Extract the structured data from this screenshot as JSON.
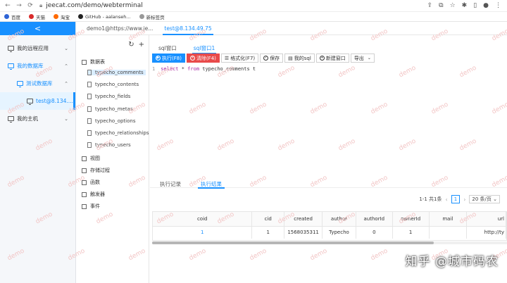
{
  "browser": {
    "url": "jeecat.com/demo/webterminal",
    "bookmarks": [
      "百度",
      "天猫",
      "淘宝",
      "GitHub - aalanseh...",
      "新标签页"
    ]
  },
  "sidebar": {
    "collapse_icon": "<",
    "items": [
      {
        "label": "我的远程应用"
      },
      {
        "label": "我的数据库"
      },
      {
        "label": "测试数据库"
      },
      {
        "label": "test@8.134...."
      },
      {
        "label": "我的主机"
      }
    ]
  },
  "tabs": [
    "demo1@https://www.je...",
    "test@8.134.49.75"
  ],
  "tree": {
    "group_tables": "数据表",
    "tables": [
      "typecho_comments",
      "typecho_contents",
      "typecho_fields",
      "typecho_metas",
      "typecho_options",
      "typecho_relationships",
      "typecho_users"
    ],
    "other_groups": [
      "视图",
      "存储过程",
      "函数",
      "触发器",
      "事件"
    ]
  },
  "editor": {
    "subtabs": [
      "sql窗口",
      "sql窗口1"
    ],
    "toolbar": {
      "run": "执行(F8)",
      "clear": "清除(F4)",
      "format": "格式化(F7)",
      "save": "保存",
      "my_sql": "我的sql",
      "new_window": "新建窗口",
      "export": "导出"
    },
    "line_no": "1",
    "sql_keyword1": "select",
    "sql_mid": " * ",
    "sql_keyword2": "from",
    "sql_rest": " typecho_comments t"
  },
  "results": {
    "tabs": [
      "执行记录",
      "执行结果"
    ],
    "pager_range": "1-1 共1条",
    "page": "1",
    "page_size": "20 条/页",
    "columns": [
      "coid",
      "cid",
      "created",
      "author",
      "authorId",
      "ownerId",
      "mail",
      "url"
    ],
    "row": [
      "1",
      "1",
      "1568035311",
      "Typecho",
      "0",
      "1",
      "",
      "http://ty"
    ]
  },
  "watermark_text": "demo",
  "corner_watermark": "知乎 @城市码农"
}
